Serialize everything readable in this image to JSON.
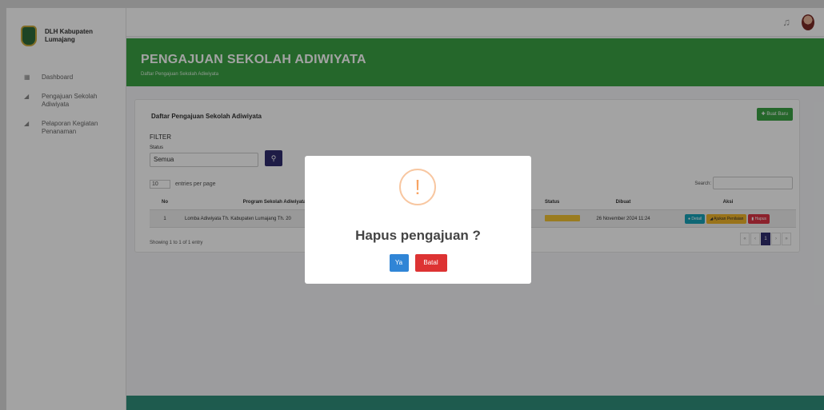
{
  "sidebar": {
    "brand": "DLH Kabupaten Lumajang",
    "items": [
      {
        "label": "Dashboard",
        "icon": "dashboard-icon"
      },
      {
        "label": "Pengajuan Sekolah Adiwiyata",
        "icon": "send-icon"
      },
      {
        "label": "Pelaporan Kegiatan Penanaman",
        "icon": "send-icon"
      }
    ]
  },
  "header": {
    "title": "PENGAJUAN SEKOLAH ADIWIYATA",
    "subtitle": "Daftar Pengajuan Sekolah Adiwiyata"
  },
  "card": {
    "title": "Daftar Pengajuan Sekolah Adiwiyata",
    "add_button": "Buat Baru",
    "filter_title": "FILTER",
    "filter_label": "Status",
    "filter_value": "Semua",
    "entries_value": "10",
    "entries_label": "entries per page",
    "search_label": "Search:",
    "columns": {
      "no": "No",
      "program": "Program Sekolah Adiwiyata",
      "status": "Status",
      "dibuat": "Dibuat",
      "aksi": "Aksi"
    },
    "rows": [
      {
        "no": "1",
        "program": "Lomba Adiwiyata Th. Kabupaten Lumajang Th. 20",
        "dibuat": "26 November 2024 11:24",
        "actions": {
          "detail": "Detail",
          "ajukan": "Ajukan Penilaian",
          "hapus": "Hapus"
        }
      }
    ],
    "info": "Showing 1 to 1 of 1 entry",
    "pager": [
      "«",
      "‹",
      "1",
      "›",
      "»"
    ]
  },
  "modal": {
    "icon": "!",
    "title": "Hapus pengajuan ?",
    "confirm": "Ya",
    "cancel": "Batal"
  },
  "colors": {
    "header_green": "#3aa244",
    "primary_navy": "#2f2c6e",
    "confirm_blue": "#3085d6",
    "cancel_red": "#dd3333",
    "warning_orange": "#f8a463"
  }
}
